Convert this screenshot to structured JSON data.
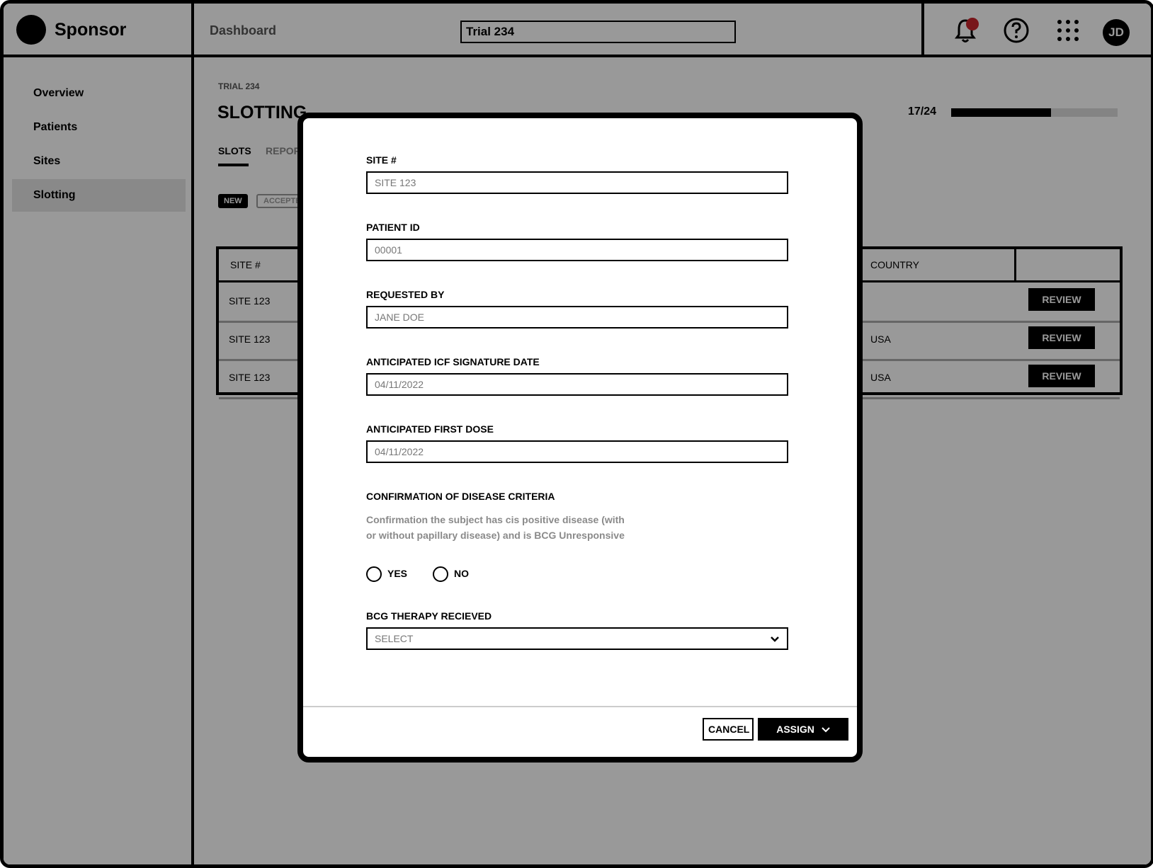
{
  "app": {
    "brand": "Sponsor",
    "section": "Dashboard",
    "trial_field_value": "Trial 234",
    "avatar_initials": "JD"
  },
  "sidebar": {
    "items": [
      {
        "label": "Overview"
      },
      {
        "label": "Patients"
      },
      {
        "label": "Sites"
      },
      {
        "label": "Slotting",
        "active": true
      }
    ]
  },
  "main": {
    "breadcrumb": "TRIAL 234",
    "title": "SLOTTING",
    "progress": {
      "text": "17/24",
      "fraction": 0.6
    },
    "tabs": [
      {
        "label": "SLOTS",
        "active": true
      },
      {
        "label": "REPOR"
      }
    ],
    "chips": [
      {
        "label": "NEW",
        "active": true
      },
      {
        "label": "ACCEPTE"
      }
    ],
    "table": {
      "headers": {
        "site": "SITE #",
        "country": "COUNTRY"
      },
      "rows": [
        {
          "site": "SITE 123",
          "country": "",
          "action": "REVIEW"
        },
        {
          "site": "SITE 123",
          "country": "USA",
          "action": "REVIEW"
        },
        {
          "site": "SITE 123",
          "country": "USA",
          "action": "REVIEW"
        }
      ]
    }
  },
  "modal": {
    "fields": {
      "site": {
        "label": "SITE #",
        "value": "SITE 123"
      },
      "patient": {
        "label": "PATIENT ID",
        "value": "00001"
      },
      "requested": {
        "label": "REQUESTED BY",
        "value": "JANE DOE"
      },
      "icf": {
        "label": "ANTICIPATED ICF SIGNATURE DATE",
        "value": "04/11/2022"
      },
      "dose": {
        "label": "ANTICIPATED FIRST DOSE",
        "value": "04/11/2022"
      }
    },
    "criteria": {
      "label": "CONFIRMATION OF DISEASE CRITERIA",
      "help": "Confirmation the subject has cis positive disease (with or without papillary disease) and is BCG Unresponsive",
      "yes": "YES",
      "no": "NO"
    },
    "bcg": {
      "label": "BCG THERAPY RECIEVED",
      "value": "SELECT"
    },
    "cancel": "CANCEL",
    "assign": "ASSIGN"
  },
  "colors": {
    "notification_dot": "#c8262c",
    "overlay": "rgba(0,0,0,0.4)"
  },
  "icons": [
    "bell-icon",
    "help-icon",
    "apps-grid-icon",
    "chevron-down-icon"
  ]
}
